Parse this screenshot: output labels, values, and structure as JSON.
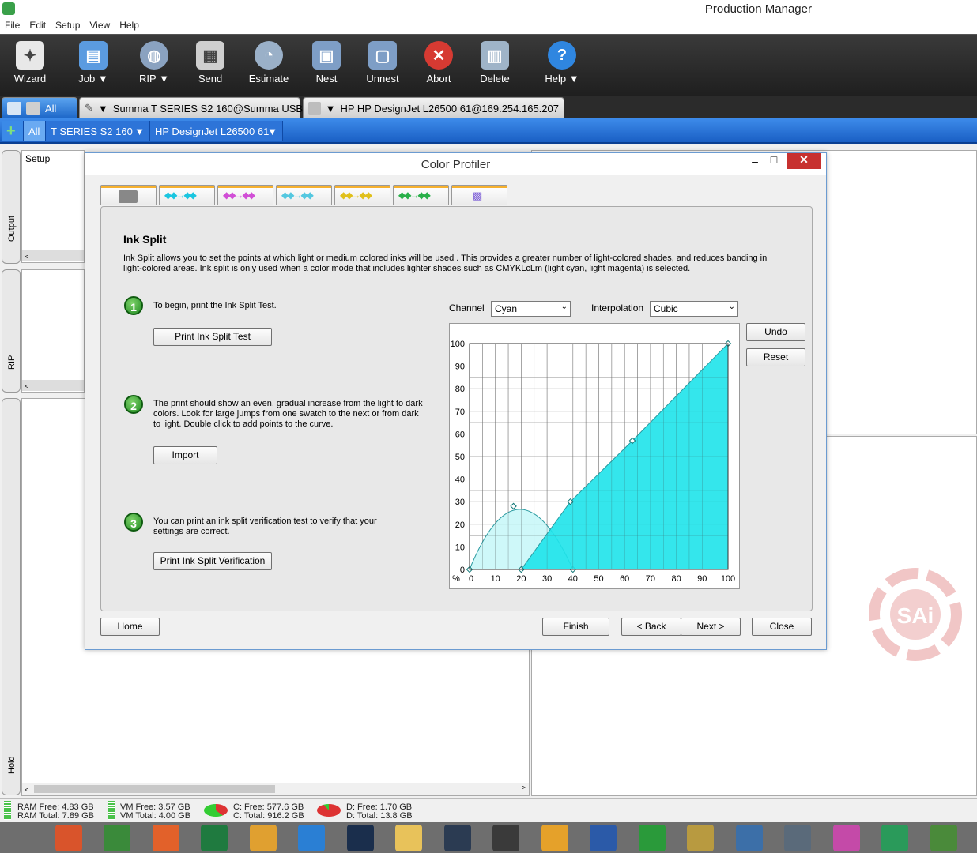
{
  "app": {
    "title": "Production Manager"
  },
  "menu": [
    "File",
    "Edit",
    "Setup",
    "View",
    "Help"
  ],
  "toolbar": [
    {
      "label": "Wizard",
      "icon": "wizard-icon",
      "glyph": "✦",
      "color": "#e8e8e8"
    },
    {
      "label": "Job  ▼",
      "icon": "job-folder-icon",
      "glyph": "▤",
      "color": "#5b9be0"
    },
    {
      "label": "RIP  ▼",
      "icon": "rip-globe-icon",
      "glyph": "◍",
      "color": "#8aa2c0"
    },
    {
      "label": "Send",
      "icon": "send-printer-icon",
      "glyph": "▦",
      "color": "#cfcfcf"
    },
    {
      "label": "Estimate",
      "icon": "estimate-gauge-icon",
      "glyph": "◔",
      "color": "#9ab0c8"
    },
    {
      "label": "Nest",
      "icon": "nest-icon",
      "glyph": "▣",
      "color": "#7e9ec6"
    },
    {
      "label": "Unnest",
      "icon": "unnest-icon",
      "glyph": "▢",
      "color": "#7e9ec6"
    },
    {
      "label": "Abort",
      "icon": "abort-icon",
      "glyph": "✕",
      "color": "#d63a32"
    },
    {
      "label": "Delete",
      "icon": "delete-trash-icon",
      "glyph": "▥",
      "color": "#9fb4c8"
    },
    {
      "label": "Help  ▼",
      "icon": "help-icon",
      "glyph": "?",
      "color": "#2f86e0"
    }
  ],
  "printer_tabs": {
    "all": "All",
    "summa": "Summa T SERIES S2 160@Summa USB",
    "hp": "HP HP DesignJet L26500 61@169.254.165.207"
  },
  "queue": {
    "all": "All",
    "q1": "T SERIES S2 160",
    "q2": "HP DesignJet L26500 61"
  },
  "side": {
    "setup": "Setup",
    "output": "Output",
    "rip": "RIP",
    "hold": "Hold"
  },
  "dialog": {
    "title": "Color Profiler",
    "heading": "Ink Split",
    "description": "Ink Split allows you to set the points at which light or medium colored inks will be used . This provides a greater number of light-colored shades, and reduces banding in light-colored areas. Ink split is only used when a color mode that includes lighter shades such as CMYKLcLm (light cyan, light magenta) is selected.",
    "step1_text": "To begin, print the Ink Split Test.",
    "step1_button": "Print Ink Split Test",
    "step2_text": "The print should show an even, gradual increase from the light to dark colors. Look for large jumps from one swatch to the next or from dark to light. Double click to add points to the curve.",
    "step2_button": "Import",
    "step3_text": "You can print an ink split verification test to verify that your settings are correct.",
    "step3_button": "Print Ink Split Verification",
    "channel_label": "Channel",
    "channel_value": "Cyan",
    "interp_label": "Interpolation",
    "interp_value": "Cubic",
    "undo": "Undo",
    "reset": "Reset",
    "home": "Home",
    "finish": "Finish",
    "back": "< Back",
    "next": "Next >",
    "close": "Close",
    "step_numbers": [
      "1",
      "2",
      "3"
    ]
  },
  "chart_data": {
    "type": "area",
    "xlabel": "%",
    "xlim": [
      0,
      100
    ],
    "ylim": [
      0,
      100
    ],
    "xticks": [
      0,
      10,
      20,
      30,
      40,
      50,
      60,
      70,
      80,
      90,
      100
    ],
    "yticks": [
      0,
      10,
      20,
      30,
      40,
      50,
      60,
      70,
      80,
      90,
      100
    ],
    "grid": true,
    "series": [
      {
        "color": "#bdf5f7",
        "points": [
          [
            0,
            0
          ],
          [
            17,
            28
          ],
          [
            40,
            0
          ]
        ]
      },
      {
        "color": "#1ee3ea",
        "points": [
          [
            20,
            0
          ],
          [
            39,
            30
          ],
          [
            63,
            57
          ],
          [
            100,
            100
          ]
        ]
      }
    ]
  },
  "status": {
    "ram_free": "RAM Free: 4.83 GB",
    "ram_total": "RAM Total: 7.89 GB",
    "vm_free": "VM Free: 3.57 GB",
    "vm_total": "VM Total: 4.00 GB",
    "c_free": "C: Free: 577.6 GB",
    "c_total": "C: Total: 916.2 GB",
    "d_free": "D: Free: 1.70 GB",
    "d_total": "D: Total: 13.8 GB"
  },
  "watermark": "SAi",
  "taskbar": [
    {
      "icon": "windows-start-icon",
      "color": "#6e6e6e"
    },
    {
      "icon": "app-bars-icon",
      "color": "#d9542b"
    },
    {
      "icon": "leaf-app-icon",
      "color": "#3a8a3a"
    },
    {
      "icon": "firefox-icon",
      "color": "#e2612a"
    },
    {
      "icon": "excel-icon",
      "color": "#1f7a3f"
    },
    {
      "icon": "app-folder-icon",
      "color": "#e0a030"
    },
    {
      "icon": "internet-explorer-icon",
      "color": "#2a7fd4"
    },
    {
      "icon": "photoshop-icon",
      "color": "#1a2e4c"
    },
    {
      "icon": "file-explorer-icon",
      "color": "#e8c25a"
    },
    {
      "icon": "app-v-icon",
      "color": "#2b3b52"
    },
    {
      "icon": "video-app-icon",
      "color": "#3a3a3a"
    },
    {
      "icon": "outlook-icon",
      "color": "#e5a12a"
    },
    {
      "icon": "word-icon",
      "color": "#2b5aa8"
    },
    {
      "icon": "store-icon",
      "color": "#2a9a3a"
    },
    {
      "icon": "pen-tool-icon",
      "color": "#b89a40"
    },
    {
      "icon": "drop-app-icon",
      "color": "#3c6fa8"
    },
    {
      "icon": "calculator-icon",
      "color": "#5a6a7a"
    },
    {
      "icon": "itunes-icon",
      "color": "#c44aa8"
    },
    {
      "icon": "fx-app-icon",
      "color": "#2a9a5a"
    },
    {
      "icon": "production-manager-icon",
      "color": "#4a8a3a"
    }
  ]
}
